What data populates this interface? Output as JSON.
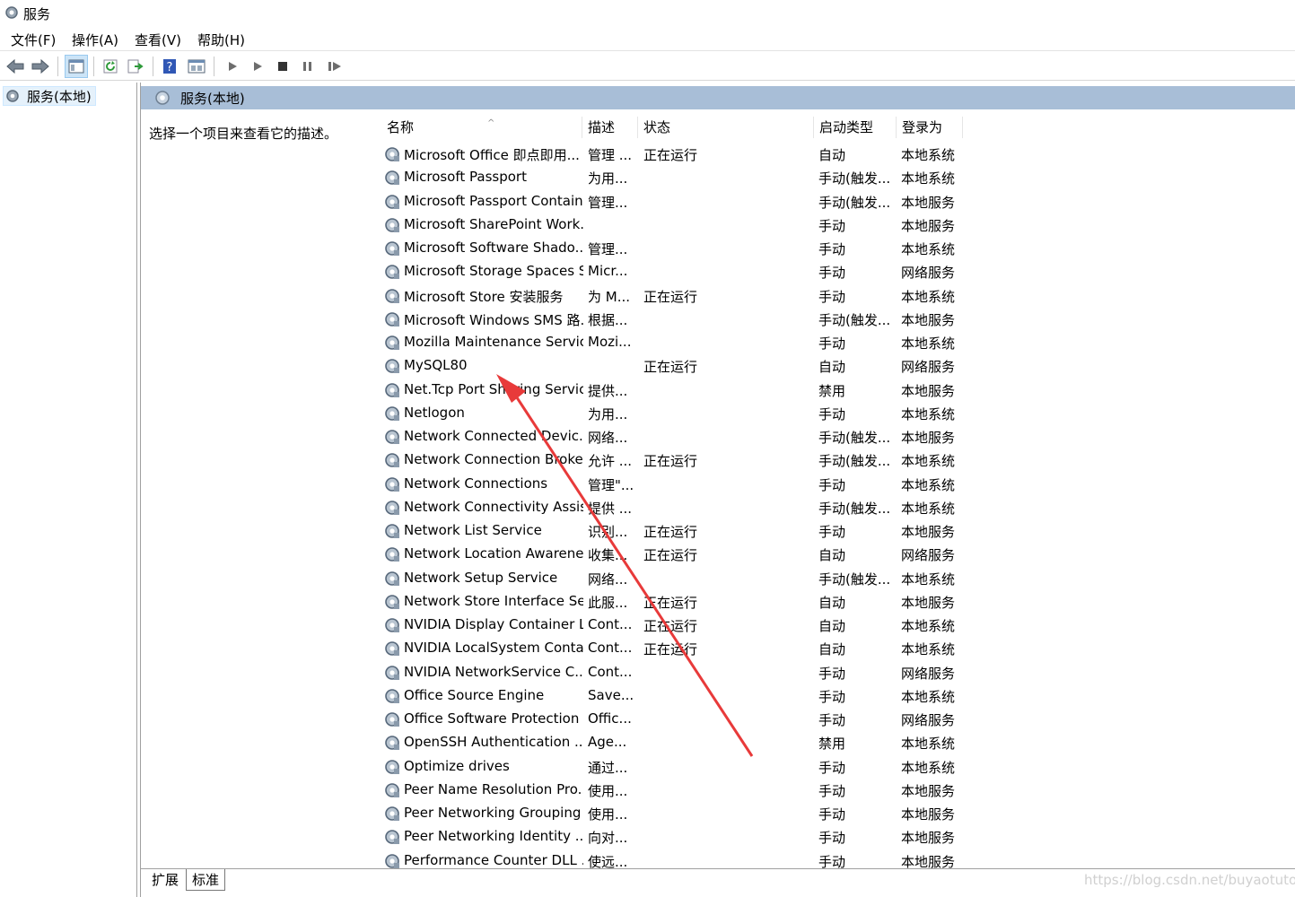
{
  "window": {
    "title": "服务",
    "icon": "services-gear-icon"
  },
  "menu": [
    "文件(F)",
    "操作(A)",
    "查看(V)",
    "帮助(H)"
  ],
  "toolbar": {
    "buttons": [
      "back-arrow-icon",
      "forward-arrow-icon",
      "console-tree-icon",
      "refresh-icon",
      "export-list-icon",
      "help-icon",
      "properties-icon",
      "start-service-icon",
      "start-alt-icon",
      "stop-service-icon",
      "pause-service-icon",
      "restart-service-icon"
    ]
  },
  "tree": {
    "root_label": "服务(本地)"
  },
  "pane": {
    "header": "服务(本地)",
    "description_hint": "选择一个项目来查看它的描述。"
  },
  "columns": [
    "名称",
    "描述",
    "状态",
    "启动类型",
    "登录为"
  ],
  "services": [
    {
      "name": "Microsoft Office 即点即用...",
      "desc": "管理 ...",
      "status": "正在运行",
      "startup": "自动",
      "logon": "本地系统"
    },
    {
      "name": "Microsoft Passport",
      "desc": "为用...",
      "status": "",
      "startup": "手动(触发...",
      "logon": "本地系统"
    },
    {
      "name": "Microsoft Passport Container",
      "desc": "管理...",
      "status": "",
      "startup": "手动(触发...",
      "logon": "本地服务"
    },
    {
      "name": "Microsoft SharePoint Work...",
      "desc": "",
      "status": "",
      "startup": "手动",
      "logon": "本地服务"
    },
    {
      "name": "Microsoft Software Shado...",
      "desc": "管理...",
      "status": "",
      "startup": "手动",
      "logon": "本地系统"
    },
    {
      "name": "Microsoft Storage Spaces S...",
      "desc": "Micr...",
      "status": "",
      "startup": "手动",
      "logon": "网络服务"
    },
    {
      "name": "Microsoft Store 安装服务",
      "desc": "为 M...",
      "status": "正在运行",
      "startup": "手动",
      "logon": "本地系统"
    },
    {
      "name": "Microsoft Windows SMS 路...",
      "desc": "根据...",
      "status": "",
      "startup": "手动(触发...",
      "logon": "本地服务"
    },
    {
      "name": "Mozilla Maintenance Service",
      "desc": "Mozi...",
      "status": "",
      "startup": "手动",
      "logon": "本地系统"
    },
    {
      "name": "MySQL80",
      "desc": "",
      "status": "正在运行",
      "startup": "自动",
      "logon": "网络服务"
    },
    {
      "name": "Net.Tcp Port Sharing Service",
      "desc": "提供...",
      "status": "",
      "startup": "禁用",
      "logon": "本地服务"
    },
    {
      "name": "Netlogon",
      "desc": "为用...",
      "status": "",
      "startup": "手动",
      "logon": "本地系统"
    },
    {
      "name": "Network Connected Devic...",
      "desc": "网络...",
      "status": "",
      "startup": "手动(触发...",
      "logon": "本地服务"
    },
    {
      "name": "Network Connection Broker",
      "desc": "允许 ...",
      "status": "正在运行",
      "startup": "手动(触发...",
      "logon": "本地系统"
    },
    {
      "name": "Network Connections",
      "desc": "管理\"...",
      "status": "",
      "startup": "手动",
      "logon": "本地系统"
    },
    {
      "name": "Network Connectivity Assis...",
      "desc": "提供 ...",
      "status": "",
      "startup": "手动(触发...",
      "logon": "本地系统"
    },
    {
      "name": "Network List Service",
      "desc": "识别...",
      "status": "正在运行",
      "startup": "手动",
      "logon": "本地服务"
    },
    {
      "name": "Network Location Awarene...",
      "desc": "收集...",
      "status": "正在运行",
      "startup": "自动",
      "logon": "网络服务"
    },
    {
      "name": "Network Setup Service",
      "desc": "网络...",
      "status": "",
      "startup": "手动(触发...",
      "logon": "本地系统"
    },
    {
      "name": "Network Store Interface Se...",
      "desc": "此服...",
      "status": "正在运行",
      "startup": "自动",
      "logon": "本地服务"
    },
    {
      "name": "NVIDIA Display Container LS",
      "desc": "Cont...",
      "status": "正在运行",
      "startup": "自动",
      "logon": "本地系统"
    },
    {
      "name": "NVIDIA LocalSystem Conta...",
      "desc": "Cont...",
      "status": "正在运行",
      "startup": "自动",
      "logon": "本地系统"
    },
    {
      "name": "NVIDIA NetworkService C...",
      "desc": "Cont...",
      "status": "",
      "startup": "手动",
      "logon": "网络服务"
    },
    {
      "name": "Office  Source Engine",
      "desc": "Save...",
      "status": "",
      "startup": "手动",
      "logon": "本地系统"
    },
    {
      "name": "Office Software Protection ...",
      "desc": "Offic...",
      "status": "",
      "startup": "手动",
      "logon": "网络服务"
    },
    {
      "name": "OpenSSH Authentication ...",
      "desc": "Age...",
      "status": "",
      "startup": "禁用",
      "logon": "本地系统"
    },
    {
      "name": "Optimize drives",
      "desc": "通过...",
      "status": "",
      "startup": "手动",
      "logon": "本地系统"
    },
    {
      "name": "Peer Name Resolution Pro...",
      "desc": "使用...",
      "status": "",
      "startup": "手动",
      "logon": "本地服务"
    },
    {
      "name": "Peer Networking Grouping",
      "desc": "使用...",
      "status": "",
      "startup": "手动",
      "logon": "本地服务"
    },
    {
      "name": "Peer Networking Identity ...",
      "desc": "向对...",
      "status": "",
      "startup": "手动",
      "logon": "本地服务"
    },
    {
      "name": "Performance Counter DLL ...",
      "desc": "使远...",
      "status": "",
      "startup": "手动",
      "logon": "本地服务"
    }
  ],
  "tabs": [
    "扩展",
    "标准"
  ],
  "watermark": "https://blog.csdn.net/buyaotutou",
  "colors": {
    "header_bar": "#a8bed7",
    "selection": "#e5f1fb",
    "annotation_arrow": "#e83a3a"
  }
}
